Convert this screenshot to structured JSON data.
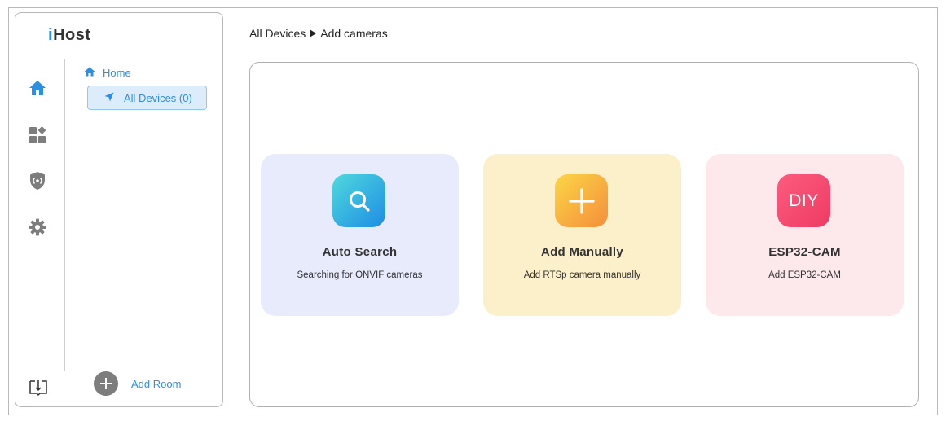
{
  "app": {
    "logo_i": "i",
    "logo_rest": "Host"
  },
  "sidebar": {
    "rail": [
      "home-icon",
      "dashboard-icon",
      "security-shield-icon",
      "settings-gear-icon",
      "manual-book-icon"
    ],
    "tree": {
      "home_label": "Home",
      "all_devices_label": "All Devices (0)"
    },
    "add_room_label": "Add Room"
  },
  "breadcrumb": {
    "parent": "All Devices",
    "current": "Add cameras"
  },
  "cards": [
    {
      "title": "Auto Search",
      "subtitle": "Searching for ONVIF cameras",
      "icon": "search-icon",
      "color": "#e8ebfc"
    },
    {
      "title": "Add Manually",
      "subtitle": "Add RTSp camera manually",
      "icon": "plus-icon",
      "color": "#fcf0ca"
    },
    {
      "title": "ESP32-CAM",
      "subtitle": "Add ESP32-CAM",
      "icon_text": "DIY",
      "color": "#fde8ec"
    }
  ],
  "colors": {
    "accent": "#2e8fe0",
    "selected_bg": "#dcecfb",
    "icon_gray": "#7d7d7d"
  }
}
